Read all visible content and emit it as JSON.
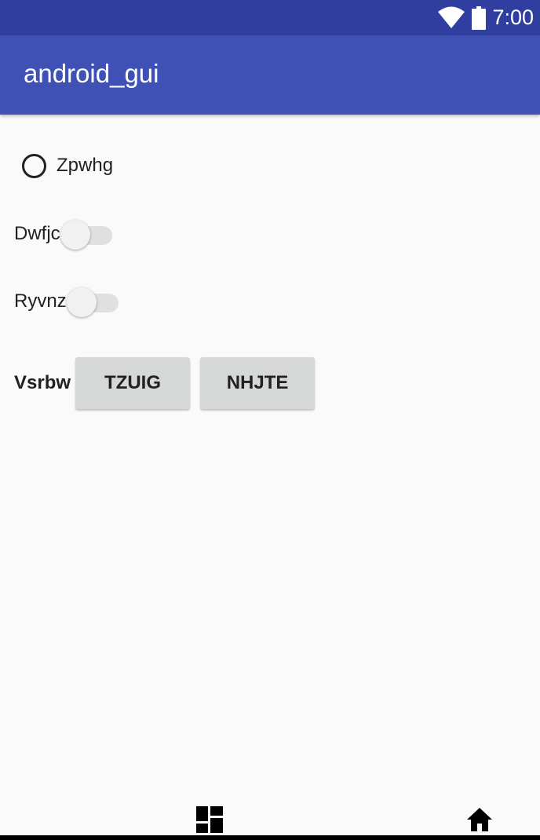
{
  "status_bar": {
    "time": "7:00",
    "wifi_icon": "wifi-icon",
    "battery_icon": "battery-icon"
  },
  "app_bar": {
    "title": "android_gui"
  },
  "radio": {
    "label": "Zpwhg",
    "checked": false
  },
  "switches": [
    {
      "label": "Dwfjc",
      "on": false
    },
    {
      "label": "Ryvnz",
      "on": false
    }
  ],
  "button_group": {
    "label": "Vsrbw",
    "buttons": [
      "TZUIG",
      "NHJTE"
    ]
  },
  "nav_bar": {
    "left_icon": "dashboard-icon",
    "right_icon": "home-icon"
  },
  "colors": {
    "status_bar": "#303f9f",
    "app_bar": "#3f51b5",
    "background": "#fafafa",
    "button": "#d6d7d7"
  }
}
